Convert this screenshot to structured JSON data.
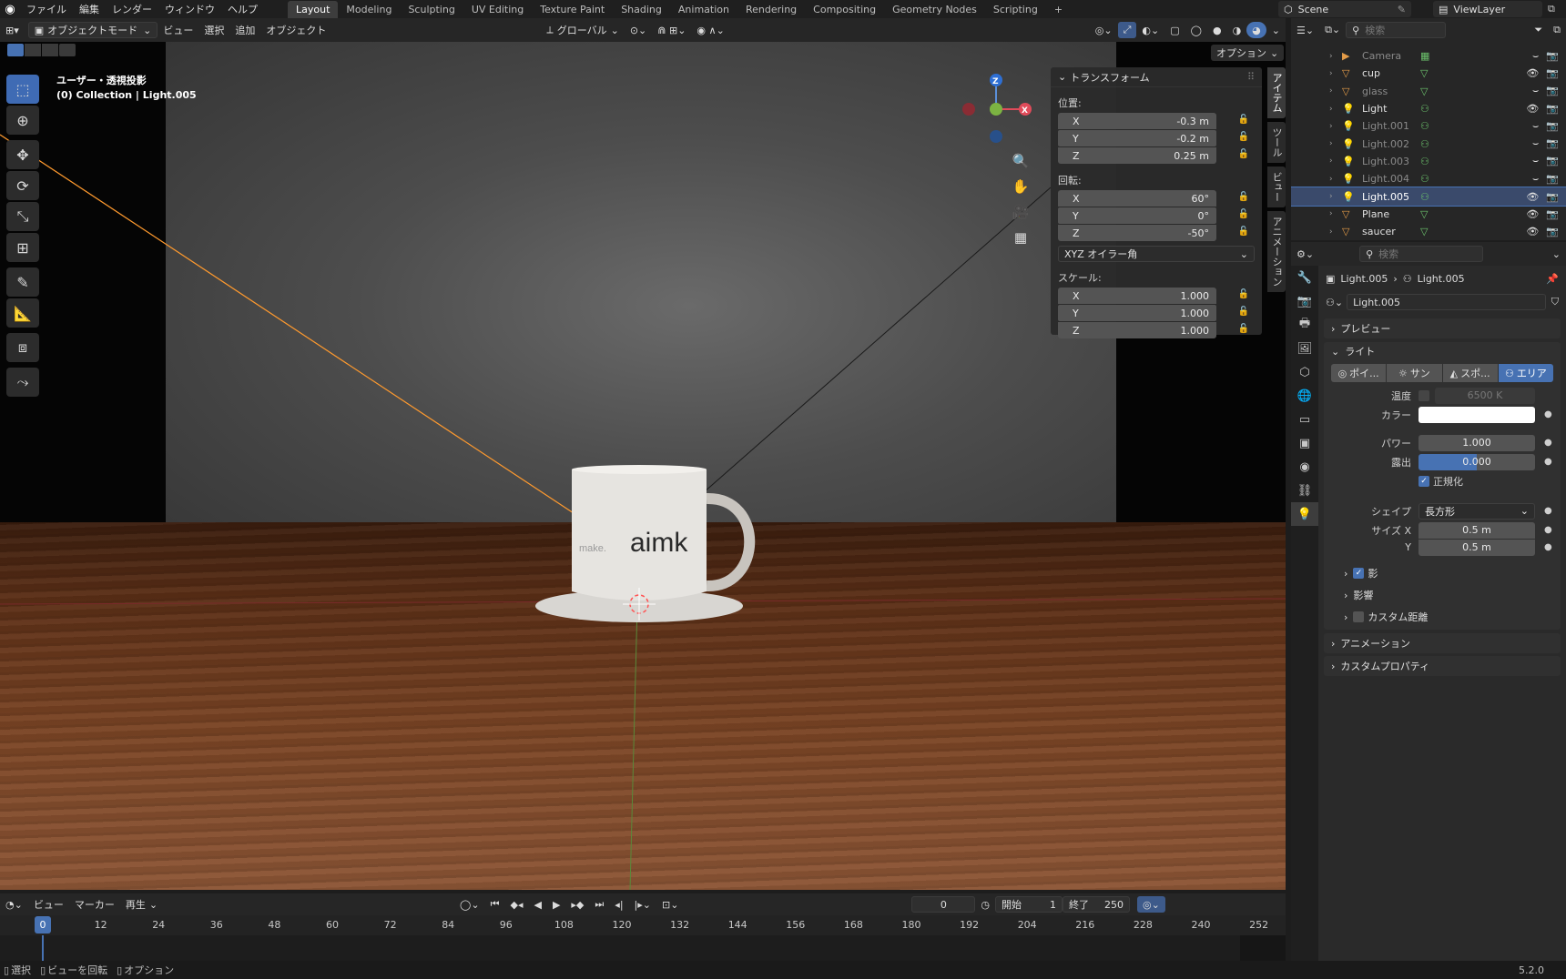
{
  "menu": [
    "ファイル",
    "編集",
    "レンダー",
    "ウィンドウ",
    "ヘルプ"
  ],
  "workspaces": [
    "Layout",
    "Modeling",
    "Sculpting",
    "UV Editing",
    "Texture Paint",
    "Shading",
    "Animation",
    "Rendering",
    "Compositing",
    "Geometry Nodes",
    "Scripting"
  ],
  "active_workspace": "Layout",
  "scene": "Scene",
  "view_layer": "ViewLayer",
  "viewport_header": {
    "mode": "オブジェクトモード",
    "view": "ビュー",
    "select": "選択",
    "add": "追加",
    "object": "オブジェクト",
    "transform_orientation": "グローバル",
    "options": "オプション"
  },
  "viewport_overlay": {
    "view_name": "ユーザー・透視投影",
    "collection_info": "(0) Collection | Light.005"
  },
  "mug_text": {
    "left": "make.",
    "right": "aimk"
  },
  "npanel": {
    "title": "トランスフォーム",
    "location_label": "位置:",
    "location": [
      {
        "axis": "X",
        "value": "-0.3 m"
      },
      {
        "axis": "Y",
        "value": "-0.2 m"
      },
      {
        "axis": "Z",
        "value": "0.25 m"
      }
    ],
    "rotation_label": "回転:",
    "rotation": [
      {
        "axis": "X",
        "value": "60°"
      },
      {
        "axis": "Y",
        "value": "0°"
      },
      {
        "axis": "Z",
        "value": "-50°"
      }
    ],
    "rotation_mode": "XYZ オイラー角",
    "scale_label": "スケール:",
    "scale": [
      {
        "axis": "X",
        "value": "1.000"
      },
      {
        "axis": "Y",
        "value": "1.000"
      },
      {
        "axis": "Z",
        "value": "1.000"
      }
    ],
    "tabs": [
      "アイテム",
      "ツール",
      "ビュー",
      "アニメーション"
    ]
  },
  "timeline": {
    "view": "ビュー",
    "marker": "マーカー",
    "playback": "再生",
    "current_frame": "0",
    "start_label": "開始",
    "start": "1",
    "end_label": "終了",
    "end": "250",
    "ticks": [
      "12",
      "24",
      "36",
      "48",
      "60",
      "72",
      "84",
      "96",
      "108",
      "120",
      "132",
      "144",
      "156",
      "168",
      "180",
      "192",
      "204",
      "216",
      "228",
      "240",
      "252"
    ],
    "playhead": "0"
  },
  "statusbar": {
    "select": "選択",
    "rotate": "ビューを回転",
    "options": "オプション",
    "version": "5.2.0"
  },
  "outliner": {
    "search_placeholder": "検索",
    "items": [
      {
        "name": "Camera",
        "icon": "camera-icon",
        "dim": true
      },
      {
        "name": "cup",
        "icon": "mesh-icon",
        "dim": false
      },
      {
        "name": "glass",
        "icon": "mesh-icon",
        "dim": true
      },
      {
        "name": "Light",
        "icon": "light-icon",
        "dim": false
      },
      {
        "name": "Light.001",
        "icon": "light-icon",
        "dim": true
      },
      {
        "name": "Light.002",
        "icon": "light-icon",
        "dim": true
      },
      {
        "name": "Light.003",
        "icon": "light-icon",
        "dim": true
      },
      {
        "name": "Light.004",
        "icon": "light-icon",
        "dim": true
      },
      {
        "name": "Light.005",
        "icon": "light-icon",
        "dim": false,
        "selected": true
      },
      {
        "name": "Plane",
        "icon": "mesh-icon",
        "dim": false
      },
      {
        "name": "saucer",
        "icon": "mesh-icon",
        "dim": false
      }
    ]
  },
  "properties": {
    "search_placeholder": "検索",
    "breadcrumb": {
      "object": "Light.005",
      "data": "Light.005"
    },
    "datablock": "Light.005",
    "preview": "プレビュー",
    "light_panel": "ライト",
    "light_types": [
      "ポイ...",
      "サン",
      "スポ...",
      "エリア"
    ],
    "active_light_type": "エリア",
    "temperature_label": "温度",
    "temperature": "6500 K",
    "color_label": "カラー",
    "color_value": "#ffffff",
    "power_label": "パワー",
    "power": "1.000",
    "exposure_label": "露出",
    "exposure": "0.000",
    "normalize": "正規化",
    "shape_label": "シェイプ",
    "shape": "長方形",
    "size_x_label": "サイズ X",
    "size_x": "0.5 m",
    "size_y_label": "Y",
    "size_y": "0.5 m",
    "shadow": "影",
    "influence": "影響",
    "custom_distance": "カスタム距離",
    "animation": "アニメーション",
    "custom_props": "カスタムプロパティ"
  },
  "colors": {
    "accent": "#4772b3",
    "light_orange": "#ff9a2e"
  }
}
